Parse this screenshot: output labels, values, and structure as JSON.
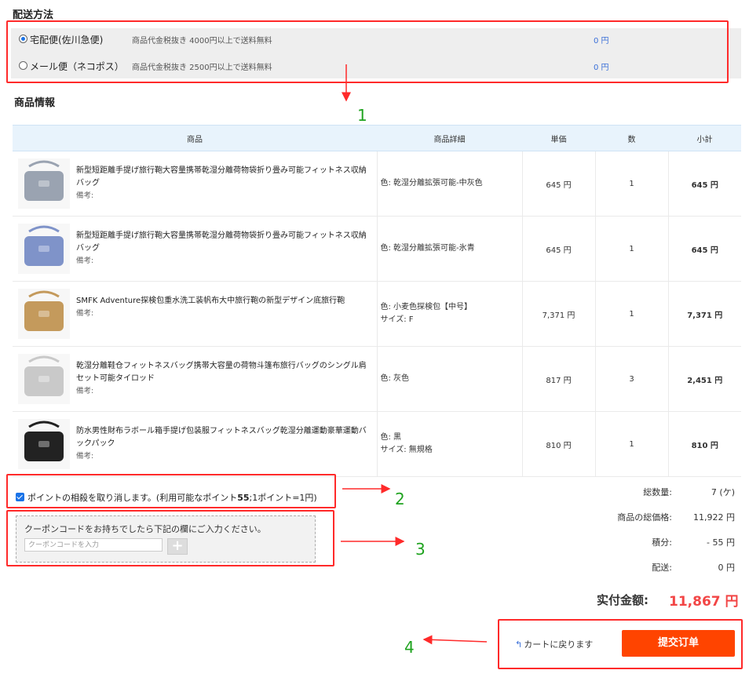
{
  "shipping": {
    "title": "配送方法",
    "options": [
      {
        "name": "宅配便(佐川急便)",
        "desc": "商品代金税抜き 4000円以上で送料無料",
        "price": "0 円",
        "selected": true
      },
      {
        "name": "メール便（ネコポス）",
        "desc": "商品代金税抜き 2500円以上で送料無料",
        "price": "0 円",
        "selected": false
      }
    ]
  },
  "products": {
    "title": "商品情報",
    "headers": [
      "商品",
      "商品詳細",
      "単価",
      "数",
      "小計"
    ],
    "note_label": "備考:",
    "rows": [
      {
        "name": "新型短距離手提げ旅行鞄大容量携帯乾湿分離荷物袋折り畳み可能フィットネス収納バッグ",
        "detail1": "色: 乾湿分離拡張可能-中灰色",
        "detail2": "",
        "price": "645 円",
        "qty": "1",
        "subtotal": "645 円",
        "thumb_color": "#9aa3b1"
      },
      {
        "name": "新型短距離手提げ旅行鞄大容量携帯乾湿分離荷物袋折り畳み可能フィットネス収納バッグ",
        "detail1": "色: 乾湿分離拡張可能-氷青",
        "detail2": "",
        "price": "645 円",
        "qty": "1",
        "subtotal": "645 円",
        "thumb_color": "#7f93c9"
      },
      {
        "name": "SMFK Adventure探検包重水洗工装帆布大中旅行鞄の新型デザイン底旅行鞄",
        "detail1": "色: 小麦色探検包【中号】",
        "detail2": "サイズ: F",
        "price": "7,371 円",
        "qty": "1",
        "subtotal": "7,371 円",
        "thumb_color": "#c49a5c"
      },
      {
        "name": "乾湿分離鞋仓フィットネスバッグ携帯大容量の荷物斗篷布旅行バッグのシングル肩セット可能タイロッド",
        "detail1": "色: 灰色",
        "detail2": "",
        "price": "817 円",
        "qty": "3",
        "subtotal": "2,451 円",
        "thumb_color": "#c9c9c9"
      },
      {
        "name": "防水男性財布ラボール箱手提げ包装服フィットネスバッグ乾湿分離運動豪華運動バックパック",
        "detail1": "色: 黒",
        "detail2": "サイズ: 無規格",
        "price": "810 円",
        "qty": "1",
        "subtotal": "810 円",
        "thumb_color": "#222222"
      }
    ]
  },
  "points": {
    "label_pre": "ポイントの相殺を取り消します。(利用可能なポイント",
    "value": "55",
    "label_post": ";1ポイント=1円)"
  },
  "coupon": {
    "message": "クーポンコードをお持ちでしたら下記の欄にご入力ください。",
    "placeholder": "クーポンコードを入力",
    "plus": "+"
  },
  "summary": {
    "rows": [
      {
        "label": "総数量:",
        "value": "7 (ケ)"
      },
      {
        "label": "商品の総価格:",
        "value": "11,922 円"
      },
      {
        "label": "積分:",
        "value": "- 55 円"
      },
      {
        "label": "配送:",
        "value": "0 円"
      }
    ],
    "total_label": "实付金额:",
    "total_value": "11,867 円"
  },
  "actions": {
    "back_label": "カートに戻ります",
    "submit_label": "提交订单"
  },
  "annotations": [
    "1",
    "2",
    "3",
    "4"
  ],
  "colors": {
    "accent": "#ff4400",
    "total": "#f24545",
    "annotation_box": "#ff2a2a",
    "annotation_text": "#1fa31f",
    "link_blue": "#3a6fd8"
  }
}
